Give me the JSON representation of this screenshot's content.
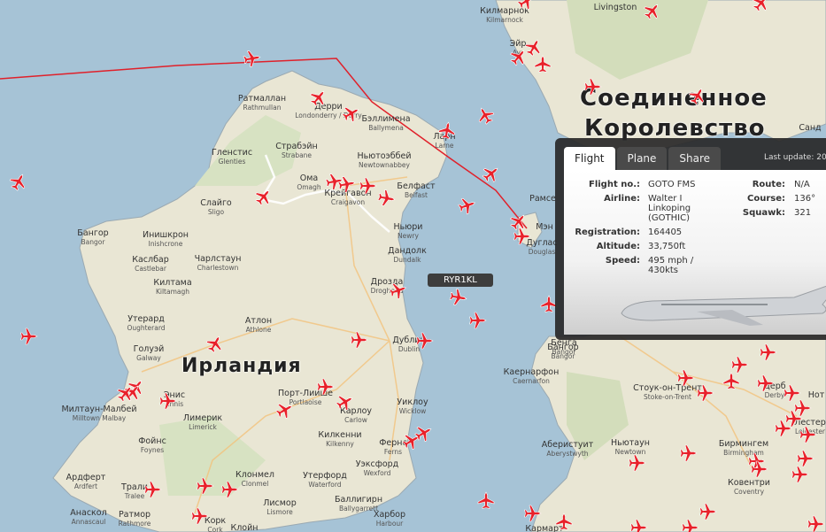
{
  "map": {
    "countries": [
      {
        "id": "uk-1",
        "text": "Соединенное"
      },
      {
        "id": "uk-2",
        "text": "Королевство"
      },
      {
        "id": "ireland",
        "text": "Ирландия"
      }
    ],
    "cities": [
      {
        "name": "Килмарнок",
        "sub": "Kilmarnock"
      },
      {
        "name": "Эйр",
        "sub": "Ayr"
      },
      {
        "name": "Ратмаллан",
        "sub": "Rathmullan"
      },
      {
        "name": "Дерри",
        "sub": "Londonderry / Derry"
      },
      {
        "name": "Бэллимена",
        "sub": "Ballymena"
      },
      {
        "name": "Ларн",
        "sub": "Larne"
      },
      {
        "name": "Страбэйн",
        "sub": "Strabane"
      },
      {
        "name": "Ньютоэббей",
        "sub": "Newtownabbey"
      },
      {
        "name": "Гленстис",
        "sub": "Glenties"
      },
      {
        "name": "Ома",
        "sub": "Omagh"
      },
      {
        "name": "Крейгавон",
        "sub": "Craigavon"
      },
      {
        "name": "Белфаст",
        "sub": "Belfast"
      },
      {
        "name": "Слайго",
        "sub": "Sligo"
      },
      {
        "name": "Ньюри",
        "sub": "Newry"
      },
      {
        "name": "Бангор",
        "sub": "Bangor"
      },
      {
        "name": "Инишкрон",
        "sub": "Inishcrone"
      },
      {
        "name": "Дандолк",
        "sub": "Dundalk"
      },
      {
        "name": "Чарлстаун",
        "sub": "Charlestown"
      },
      {
        "name": "Каслбар",
        "sub": "Castlebar"
      },
      {
        "name": "Килтама",
        "sub": "Kiltamagh"
      },
      {
        "name": "Дрозда",
        "sub": "Drogheda"
      },
      {
        "name": "Утерард",
        "sub": "Oughterard"
      },
      {
        "name": "Атлон",
        "sub": "Athlone"
      },
      {
        "name": "Дублин",
        "sub": "Dublin"
      },
      {
        "name": "Голуэй",
        "sub": "Galway"
      },
      {
        "name": "Бангор",
        "sub": "Bangor"
      },
      {
        "name": "Каернарфон",
        "sub": "Caernarfon"
      },
      {
        "name": "Энис",
        "sub": "Ennis"
      },
      {
        "name": "Порт-Лиише",
        "sub": "Portlaoise"
      },
      {
        "name": "Карлоу",
        "sub": "Carlow"
      },
      {
        "name": "Уиклоу",
        "sub": "Wicklow"
      },
      {
        "name": "Милтаун-Малбей",
        "sub": "Milltown Malbay"
      },
      {
        "name": "Лимерик",
        "sub": "Limerick"
      },
      {
        "name": "Фойнс",
        "sub": "Foynes"
      },
      {
        "name": "Килкенни",
        "sub": "Kilkenny"
      },
      {
        "name": "Фернс",
        "sub": "Ferns"
      },
      {
        "name": "Стоук-он-Трент",
        "sub": "Stoke-on-Trent"
      },
      {
        "name": "Дерб",
        "sub": "Derby"
      },
      {
        "name": "Ньютаун",
        "sub": "Newtown"
      },
      {
        "name": "Бирмингем",
        "sub": "Birmingham"
      },
      {
        "name": "Аберистуит",
        "sub": "Aberystwyth"
      },
      {
        "name": "Ардферт",
        "sub": "Ardfert"
      },
      {
        "name": "Трали",
        "sub": "Tralee"
      },
      {
        "name": "Клонмел",
        "sub": "Clonmel"
      },
      {
        "name": "Утерфорд",
        "sub": "Waterford"
      },
      {
        "name": "Уэксфорд",
        "sub": "Wexford"
      },
      {
        "name": "Анаскол",
        "sub": "Annascaul"
      },
      {
        "name": "Ратмор",
        "sub": "Rathmore"
      },
      {
        "name": "Корк",
        "sub": "Cork"
      },
      {
        "name": "Клойн",
        "sub": "Cloyne"
      },
      {
        "name": "Лисмор",
        "sub": "Lismore"
      },
      {
        "name": "Баллигирн",
        "sub": "Ballygarrett"
      },
      {
        "name": "Харбор",
        "sub": "Harbour"
      },
      {
        "name": "Ковентри",
        "sub": "Coventry"
      },
      {
        "name": "Кармарт",
        "sub": ""
      },
      {
        "name": "Рамсе",
        "sub": ""
      },
      {
        "name": "Мэн",
        "sub": ""
      },
      {
        "name": "Дуглас",
        "sub": "Douglas"
      },
      {
        "name": "Бенга",
        "sub": "Bangor"
      },
      {
        "name": "Санд",
        "sub": ""
      },
      {
        "name": "Нот",
        "sub": ""
      },
      {
        "name": "Лестер",
        "sub": "Leicester"
      },
      {
        "name": "Livingston",
        "sub": ""
      }
    ],
    "flight_label": "RYR1KL",
    "plane_color": "#e8212a",
    "track_color": "#e0202a"
  },
  "panel": {
    "tabs": [
      "Flight",
      "Plane",
      "Share"
    ],
    "active_tab": "Flight",
    "last_update": "Last update: 20",
    "fields": {
      "flight_no_label": "Flight no.:",
      "flight_no": "GOTO FMS",
      "airline_label": "Airline:",
      "airline": "Walter I Linkoping (GOTHIC)",
      "registration_label": "Registration:",
      "registration": "164405",
      "altitude_label": "Altitude:",
      "altitude": "33,750ft",
      "speed_label": "Speed:",
      "speed": "495 mph / 430kts",
      "route_label": "Route:",
      "route": "N/A",
      "course_label": "Course:",
      "course": "136°",
      "squawk_label": "Squawk:",
      "squawk": "321"
    }
  }
}
